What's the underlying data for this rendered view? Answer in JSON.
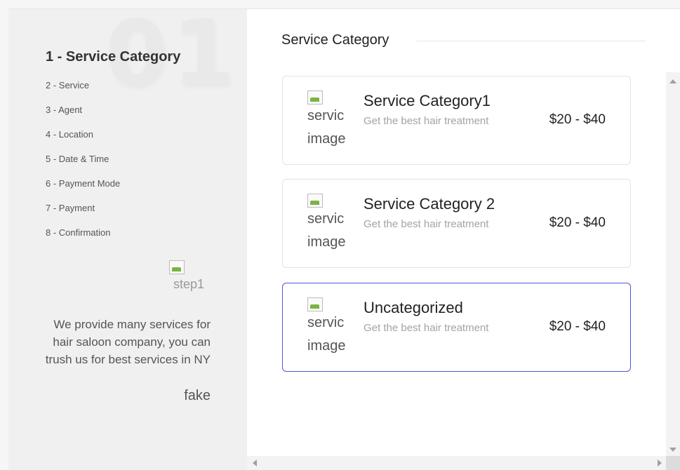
{
  "left_panel": {
    "big_number": "01",
    "active_step": "1 - Service Category",
    "steps": [
      "2 - Service",
      "3 - Agent",
      "4 - Location",
      "5 - Date & Time",
      "6 - Payment Mode",
      "7 - Payment",
      "8 - Confirmation"
    ],
    "step_image_alt": "step1",
    "description": "We provide many services for hair saloon company, you can trush us for best services in NY",
    "extra": "fake"
  },
  "main": {
    "heading": "Service Category",
    "cards": [
      {
        "image_alt": "servic\nimage",
        "title": "Service Category1",
        "subtitle": "Get the best hair treatment",
        "price": "$20 - $40",
        "selected": false
      },
      {
        "image_alt": "servic\nimage",
        "title": "Service Category 2",
        "subtitle": "Get the best hair treatment",
        "price": "$20 - $40",
        "selected": false
      },
      {
        "image_alt": "servic\nimage",
        "title": "Uncategorized",
        "subtitle": "Get the best hair treatment",
        "price": "$20 - $40",
        "selected": true
      }
    ]
  },
  "colors": {
    "accent": "#4b57d6",
    "left_bg": "#f0f0f0",
    "right_bg": "#ffffff"
  }
}
